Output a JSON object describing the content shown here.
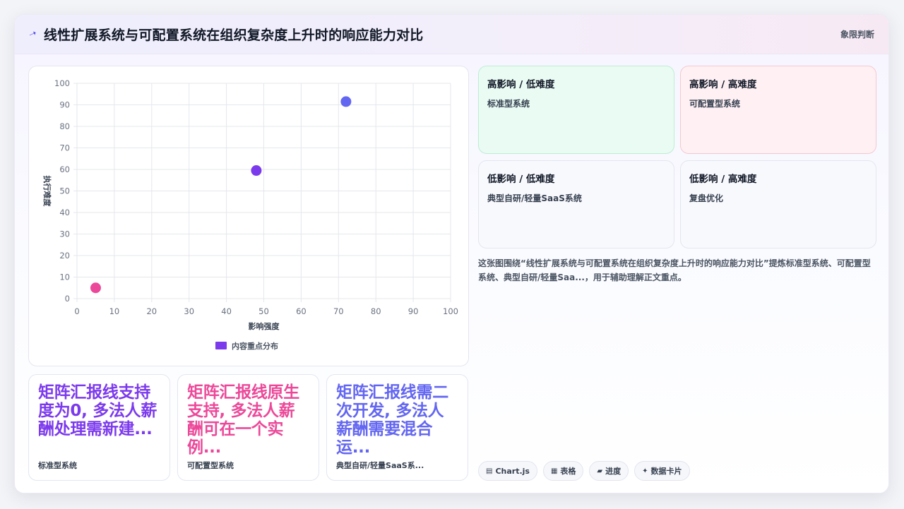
{
  "header": {
    "title": "线性扩展系统与可配置系统在组织复杂度上升时的响应能力对比",
    "tag": "象限判断"
  },
  "chart_data": {
    "type": "scatter",
    "xlabel": "影响强度",
    "ylabel": "执行难度",
    "xlim": [
      0,
      100
    ],
    "ylim": [
      0,
      100
    ],
    "xticks": [
      0,
      10,
      20,
      30,
      40,
      50,
      60,
      70,
      80,
      90,
      100
    ],
    "yticks": [
      0,
      10,
      20,
      30,
      40,
      50,
      60,
      70,
      80,
      90,
      100
    ],
    "grid": true,
    "legend": "bottom",
    "series": [
      {
        "name": "内容重点分布",
        "points": [
          {
            "x": 5,
            "y": 5,
            "color": "#ec4899"
          },
          {
            "x": 48,
            "y": 59.5,
            "color": "#7c3aed"
          },
          {
            "x": 72,
            "y": 91.5,
            "color": "#6366f1"
          }
        ]
      }
    ],
    "legend_color": "#7c3aed"
  },
  "quadrants": [
    {
      "title": "高影响 / 低难度",
      "item": "标准型系统"
    },
    {
      "title": "高影响 / 高难度",
      "item": "可配置型系统"
    },
    {
      "title": "低影响 / 低难度",
      "item": "典型自研/轻量SaaS系统"
    },
    {
      "title": "低影响 / 高难度",
      "item": "复盘优化"
    }
  ],
  "description": "这张图围绕“线性扩展系统与可配置系统在组织复杂度上升时的响应能力对比”提炼标准型系统、可配置型系统、典型自研/轻量Saa...，用于辅助理解正文重点。",
  "stats": [
    {
      "value": "矩阵汇报线支持度为0, 多法人薪酬处理需新建...",
      "label": "标准型系统"
    },
    {
      "value": "矩阵汇报线原生支持, 多法人薪酬可在一个实例...",
      "label": "可配置型系统"
    },
    {
      "value": "矩阵汇报线需二次开发, 多法人薪酬需要混合运...",
      "label": "典型自研/轻量SaaS系..."
    }
  ],
  "pills": [
    {
      "icon": "▤",
      "label": "Chart.js",
      "icon_name": "chart-icon"
    },
    {
      "icon": "▦",
      "label": "表格",
      "icon_name": "table-icon"
    },
    {
      "icon": "▰",
      "label": "进度",
      "icon_name": "progress-icon"
    },
    {
      "icon": "✦",
      "label": "数据卡片",
      "icon_name": "sparkle-icon"
    }
  ],
  "colors": {
    "accent": "#6366f1",
    "purple": "#7c3aed",
    "pink": "#ec4899"
  }
}
